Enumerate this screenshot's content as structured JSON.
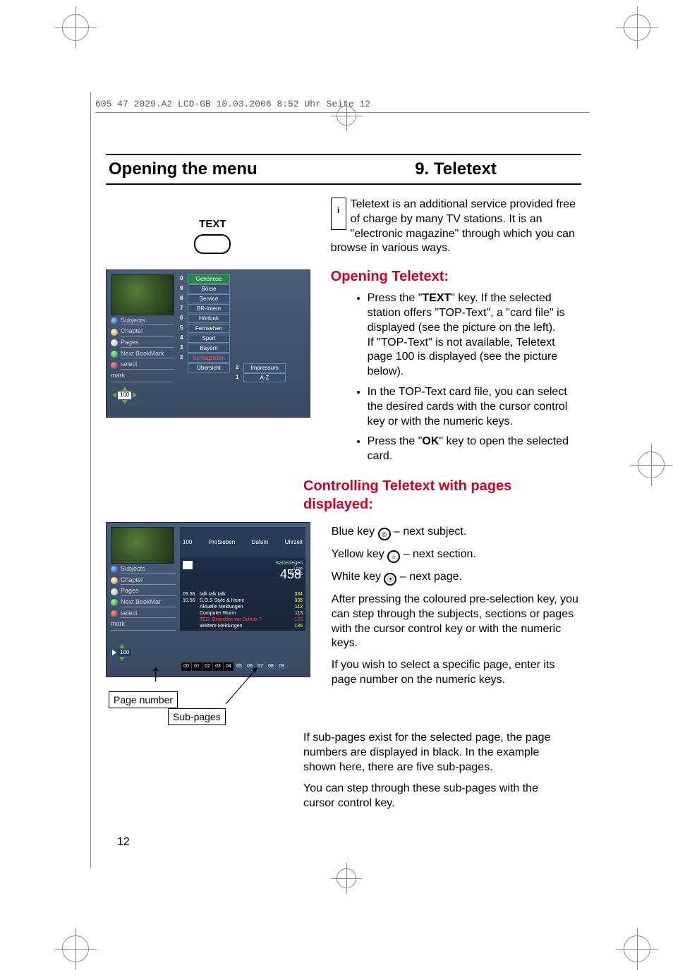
{
  "header_line": "605 47 2029.A2 LCD-GB  10.03.2006  8:52 Uhr  Seite 12",
  "title": {
    "left": "Opening the menu",
    "right": "9. Teletext"
  },
  "text_button_label": "TEXT",
  "info_letter": "i",
  "intro_paragraph": "Teletext is an additional service provided free of charge by many TV stations. It is an \"electronic magazine\" through which you can browse in various ways.",
  "section_opening": "Opening Teletext:",
  "bullets_opening": [
    {
      "pre": "Press the \"",
      "bold": "TEXT",
      "post": "\" key. If the selected station offers \"TOP-Text\", a \"card file\" is displayed (see the picture on the left)."
    },
    {
      "plain": "If \"TOP-Text\" is not available, Teletext page 100 is displayed (see the picture below)."
    },
    {
      "plain": "In the TOP-Text card file, you can select the desired cards with the cursor control key or with the numeric keys."
    },
    {
      "pre": "Press the \"",
      "bold": "OK",
      "post": "\" key to open the selected card."
    }
  ],
  "section_control": "Controlling Teletext with pages displayed:",
  "keys": {
    "blue": "Blue key",
    "blue_desc": " – next subject.",
    "yellow": "Yellow key",
    "yellow_desc": " – next section.",
    "white": "White key",
    "white_desc": " – next page."
  },
  "control_paras": [
    "After pressing the coloured pre-selection key, you can step through the subjects, sections or pages with the cursor control key or with the numeric keys.",
    "If you wish to select a specific page, enter its page number on the numeric keys."
  ],
  "sub_paras": [
    "If sub-pages exist for the selected page, the page numbers are displayed in black. In the example shown here, there are five sub-pages.",
    "You can step through these sub-pages with the cursor control key."
  ],
  "screenshot1": {
    "menu": [
      "Subjects",
      "Chapter",
      "Pages",
      "Next BookMark",
      "select"
    ],
    "mark": "mark",
    "page_number": "100",
    "cards_col1": [
      {
        "n": "0",
        "t": "Gehörlose"
      },
      {
        "n": "9",
        "t": "Börse"
      },
      {
        "n": "8",
        "t": "Service"
      },
      {
        "n": "7",
        "t": "BR-Intern"
      },
      {
        "n": "6",
        "t": "Hörfunk"
      },
      {
        "n": "5",
        "t": "Fernsehen"
      },
      {
        "n": "4",
        "t": "Sport"
      },
      {
        "n": "3",
        "t": "Bayern"
      },
      {
        "n": "2",
        "t": "Schlagzeilen"
      },
      {
        "n": "",
        "t": "Übersicht"
      }
    ],
    "cards_col2": [
      {
        "n": "2",
        "t": "Impressum"
      },
      {
        "n": "1",
        "t": "A-Z"
      }
    ]
  },
  "screenshot2": {
    "menu": [
      "Subjects",
      "Chapter",
      "Pages",
      "Next BookMar",
      "select"
    ],
    "mark": "mark",
    "page_number": "100",
    "head": {
      "num": "100",
      "name": "ProSieben",
      "date": "Datum",
      "time": "Uhrzeit"
    },
    "banner": [
      "Kartenlegen",
      "Live",
      "Gratis"
    ],
    "big": "458",
    "lines": [
      {
        "l": "09.56",
        "m": "talk talk talk",
        "r": "334"
      },
      {
        "l": "10.56",
        "m": "S.O.S Style & Home",
        "r": "335"
      },
      {
        "l": "",
        "m": "Aktuelle Meldungen",
        "r": "112"
      },
      {
        "l": "",
        "m": "Computer Wurm",
        "r": "113"
      },
      {
        "l": "",
        "m": "TED: Brauchen wir Schutz ?",
        "r": "123",
        "red": true
      },
      {
        "l": "",
        "m": "Weitere Meldungen",
        "r": "135"
      }
    ],
    "subpages": [
      "00",
      "01",
      "02",
      "03",
      "04",
      "05",
      "06",
      "07",
      "08",
      "09"
    ]
  },
  "callouts": {
    "page_number": "Page number",
    "sub_pages": "Sub-pages"
  },
  "page_number": "12"
}
